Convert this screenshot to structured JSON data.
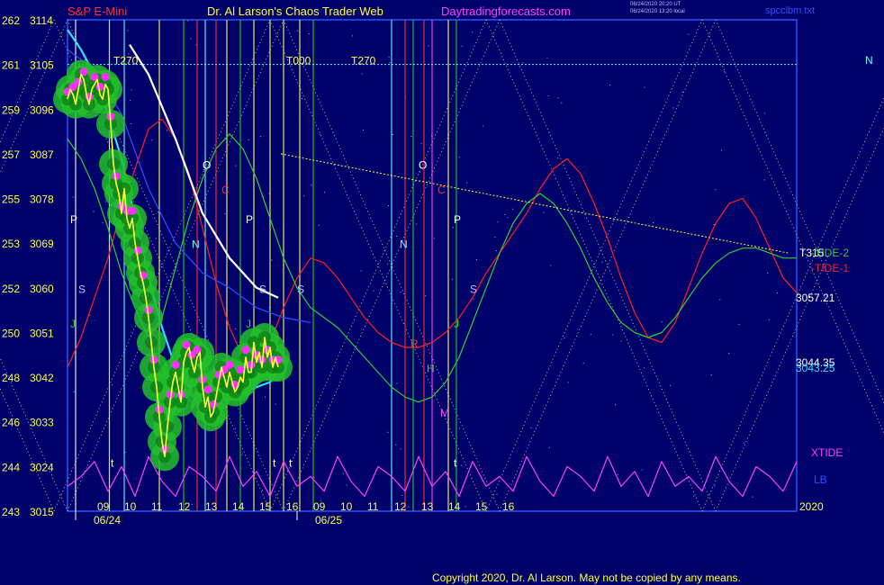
{
  "header": {
    "instrument": "S&P E-Mini",
    "title": "Dr. Al Larson's Chaos Trader Web",
    "site": "Daytradingforecasts.com",
    "stamp1": "06/24/2020 20:20 UT",
    "stamp2": "06/24/2020 13:20 local",
    "file": "spcclbm.txt"
  },
  "copyright": "Copyright 2020, Dr. Al Larson. May not be copied by any means.",
  "colors": {
    "background": "#00006a",
    "frame": "#2a52ff",
    "price": "#ffff40",
    "band": "#22c02a",
    "dots": "#ff30ff",
    "cyan_avg": "#30e0ff",
    "white_avg": "#ffffff",
    "tide1": "#ff2020",
    "tide2": "#30d030",
    "xtide": "#ff40ff"
  },
  "chart_data": {
    "type": "line",
    "ylim": [
      3015,
      3114
    ],
    "y_ticks": [
      {
        "left": "262",
        "right": "3114",
        "v": 3114
      },
      {
        "left": "261",
        "right": "3105",
        "v": 3105
      },
      {
        "left": "259",
        "right": "3096",
        "v": 3096
      },
      {
        "left": "257",
        "right": "3087",
        "v": 3087
      },
      {
        "left": "255",
        "right": "3078",
        "v": 3078
      },
      {
        "left": "253",
        "right": "3069",
        "v": 3069
      },
      {
        "left": "252",
        "right": "3060",
        "v": 3060
      },
      {
        "left": "250",
        "right": "3051",
        "v": 3051
      },
      {
        "left": "248",
        "right": "3042",
        "v": 3042
      },
      {
        "left": "246",
        "right": "3033",
        "v": 3033
      },
      {
        "left": "244",
        "right": "3024",
        "v": 3024
      },
      {
        "left": "243",
        "right": "3015",
        "v": 3015
      }
    ],
    "x_range": [
      0,
      27
    ],
    "x_ticks": [
      {
        "t": 1,
        "label": "09"
      },
      {
        "t": 2,
        "label": "10"
      },
      {
        "t": 3,
        "label": "11"
      },
      {
        "t": 4,
        "label": "12"
      },
      {
        "t": 5,
        "label": "13"
      },
      {
        "t": 6,
        "label": "14"
      },
      {
        "t": 7,
        "label": "15"
      },
      {
        "t": 8,
        "label": "16"
      },
      {
        "t": 9,
        "label": "09"
      },
      {
        "t": 10,
        "label": "10"
      },
      {
        "t": 11,
        "label": "11"
      },
      {
        "t": 12,
        "label": "12"
      },
      {
        "t": 13,
        "label": "13"
      },
      {
        "t": 14,
        "label": "14"
      },
      {
        "t": 15,
        "label": "15"
      },
      {
        "t": 16,
        "label": "16"
      }
    ],
    "dates": [
      {
        "t": 0.3,
        "label": "06/24"
      },
      {
        "t": 8.5,
        "label": "06/25"
      }
    ],
    "year_label": "2020",
    "price_series": {
      "x": [
        0.0,
        0.1,
        0.2,
        0.3,
        0.4,
        0.5,
        0.6,
        0.7,
        0.8,
        0.9,
        1.0,
        1.1,
        1.2,
        1.3,
        1.4,
        1.5,
        1.6,
        1.7,
        1.8,
        1.9,
        2.0,
        2.1,
        2.2,
        2.3,
        2.4,
        2.5,
        2.6,
        2.7,
        2.8,
        2.9,
        3.0,
        3.1,
        3.2,
        3.3,
        3.4,
        3.5,
        3.6,
        3.7,
        3.8,
        3.9,
        4.0,
        4.1,
        4.2,
        4.3,
        4.4,
        4.5,
        4.6,
        4.7,
        4.8,
        4.9,
        5.0,
        5.1,
        5.2,
        5.3,
        5.4,
        5.5,
        5.6,
        5.7,
        5.8,
        5.9,
        6.0,
        6.1,
        6.2,
        6.3,
        6.4,
        6.5,
        6.6,
        6.7,
        6.8,
        6.9,
        7.0,
        7.1,
        7.2,
        7.3,
        7.4,
        7.5,
        7.6,
        7.7,
        7.8
      ],
      "y": [
        3098,
        3100,
        3099,
        3097,
        3100,
        3103,
        3102,
        3099,
        3097,
        3100,
        3101,
        3102,
        3099,
        3098,
        3101,
        3100,
        3093,
        3085,
        3081,
        3079,
        3075,
        3080,
        3074,
        3072,
        3074,
        3069,
        3066,
        3063,
        3061,
        3058,
        3054,
        3049,
        3044,
        3040,
        3034,
        3029,
        3026,
        3032,
        3037,
        3041,
        3043,
        3040,
        3037,
        3045,
        3047,
        3048,
        3045,
        3043,
        3046,
        3047,
        3040,
        3036,
        3038,
        3034,
        3035,
        3038,
        3041,
        3044,
        3042,
        3040,
        3043,
        3041,
        3039,
        3040,
        3042,
        3041,
        3046,
        3043,
        3043,
        3049,
        3045,
        3047,
        3044,
        3050,
        3046,
        3048,
        3044,
        3046,
        3044
      ]
    },
    "series": [
      {
        "name": "-TIDE-1",
        "end_value": 3060,
        "x": [
          0,
          0.5,
          1,
          1.5,
          2,
          2.5,
          3,
          3.5,
          4,
          4.5,
          5,
          5.5,
          6,
          6.5,
          7,
          7.5,
          8,
          8.5,
          9,
          9.5,
          10,
          10.5,
          11,
          11.5,
          12,
          12.5,
          13,
          13.5,
          14,
          14.5,
          15,
          15.5,
          16,
          16.5,
          17,
          17.5,
          18,
          18.5,
          19,
          19.5,
          20,
          20.5,
          21,
          21.5,
          22,
          22.5,
          23,
          23.5,
          24,
          24.5,
          25,
          25.5,
          26,
          26.5,
          27
        ],
        "y": [
          3044,
          3050,
          3058,
          3066,
          3076,
          3084,
          3092,
          3094,
          3090,
          3083,
          3072,
          3061,
          3052,
          3046,
          3045,
          3049,
          3056,
          3062,
          3066,
          3065,
          3062,
          3058,
          3054,
          3051,
          3049,
          3048,
          3048,
          3049,
          3051,
          3054,
          3058,
          3063,
          3067,
          3071,
          3075,
          3080,
          3084,
          3086,
          3083,
          3077,
          3070,
          3062,
          3055,
          3050,
          3049,
          3053,
          3060,
          3067,
          3073,
          3077,
          3078,
          3074,
          3068,
          3062,
          3059
        ]
      },
      {
        "name": "-TIDE-2",
        "end_value": 3066,
        "x": [
          0,
          0.5,
          1,
          1.5,
          2,
          2.5,
          3,
          3.5,
          4,
          4.5,
          5,
          5.5,
          6,
          6.5,
          7,
          7.5,
          8,
          8.5,
          9,
          9.5,
          10,
          10.5,
          11,
          11.5,
          12,
          12.5,
          13,
          13.5,
          14,
          14.5,
          15,
          15.5,
          16,
          16.5,
          17,
          17.5,
          18,
          18.5,
          19,
          19.5,
          20,
          20.5,
          21,
          21.5,
          22,
          22.5,
          23,
          23.5,
          24,
          24.5,
          25,
          25.5,
          26,
          26.5,
          27
        ],
        "y": [
          3090,
          3086,
          3080,
          3072,
          3063,
          3056,
          3050,
          3054,
          3064,
          3074,
          3082,
          3088,
          3091,
          3088,
          3082,
          3074,
          3066,
          3060,
          3056,
          3054,
          3052,
          3049,
          3046,
          3043,
          3040,
          3038,
          3037,
          3038,
          3041,
          3046,
          3053,
          3060,
          3067,
          3073,
          3077,
          3079,
          3077,
          3073,
          3068,
          3062,
          3057,
          3053,
          3051,
          3050,
          3051,
          3054,
          3058,
          3062,
          3065,
          3067,
          3068,
          3068,
          3067,
          3066,
          3066
        ]
      },
      {
        "name": "XTIDE",
        "end_value": 3025,
        "x": [
          0,
          0.5,
          1,
          1.5,
          2,
          2.5,
          3,
          3.5,
          4,
          4.5,
          5,
          5.5,
          6,
          6.5,
          7,
          7.5,
          8,
          8.5,
          9,
          9.5,
          10,
          10.5,
          11,
          11.5,
          12,
          12.5,
          13,
          13.5,
          14,
          14.5,
          15,
          15.5,
          16,
          16.5,
          17,
          17.5,
          18,
          18.5,
          19,
          19.5,
          20,
          20.5,
          21,
          21.5,
          22,
          22.5,
          23,
          23.5,
          24,
          24.5,
          25,
          25.5,
          26,
          26.5,
          27
        ],
        "y": [
          3020,
          3022,
          3025,
          3019,
          3024,
          3018,
          3026,
          3021,
          3018,
          3024,
          3022,
          3019,
          3026,
          3020,
          3023,
          3018,
          3025,
          3020,
          3022,
          3019,
          3026,
          3021,
          3018,
          3024,
          3022,
          3019,
          3026,
          3020,
          3023,
          3018,
          3025,
          3020,
          3022,
          3019,
          3026,
          3021,
          3018,
          3024,
          3022,
          3019,
          3026,
          3020,
          3023,
          3018,
          3025,
          3020,
          3022,
          3019,
          3026,
          3021,
          3018,
          3024,
          3022,
          3019,
          3025
        ]
      },
      {
        "name": "cyan-average",
        "end_value": 3043.25,
        "x": [
          0,
          0.5,
          1,
          1.5,
          2,
          2.5,
          3,
          3.5,
          4,
          4.5,
          5,
          5.5,
          6,
          6.5,
          7,
          7.5,
          7.8
        ],
        "y": [
          3112,
          3108,
          3103,
          3095,
          3086,
          3074,
          3062,
          3052,
          3044,
          3040,
          3041,
          3040,
          3038,
          3039,
          3040,
          3041,
          3043.25
        ]
      },
      {
        "name": "white-average",
        "x": [
          2.3,
          3,
          4,
          5,
          6,
          7,
          7.8
        ],
        "y": [
          3109,
          3103,
          3090,
          3075,
          3066,
          3060,
          3058
        ]
      },
      {
        "name": "blue-average",
        "x": [
          0,
          1,
          2,
          3,
          4,
          5,
          6,
          7,
          8,
          9
        ],
        "y": [
          3108,
          3104,
          3095,
          3080,
          3069,
          3063,
          3060,
          3056,
          3054,
          3053
        ]
      }
    ],
    "right_values": [
      "3057.21",
      "3044.35",
      "3043.25"
    ],
    "trend_line": {
      "x": [
        7.9,
        26.7
      ],
      "y": [
        3087,
        3067
      ]
    },
    "vlines": [
      {
        "t": 0.3,
        "c": "#ffffff"
      },
      {
        "t": 1.55,
        "c": "#ffff60"
      },
      {
        "t": 2.1,
        "c": "#60ffff"
      },
      {
        "t": 3.4,
        "c": "#ffff60"
      },
      {
        "t": 4.3,
        "c": "#20d020"
      },
      {
        "t": 4.8,
        "c": "#ff3030"
      },
      {
        "t": 5.1,
        "c": "#60ffff"
      },
      {
        "t": 5.5,
        "c": "#ff3030"
      },
      {
        "t": 5.9,
        "c": "#ffff60"
      },
      {
        "t": 6.4,
        "c": "#20d020"
      },
      {
        "t": 6.9,
        "c": "#ffff60"
      },
      {
        "t": 7.5,
        "c": "#ffff60"
      },
      {
        "t": 8.0,
        "c": "#ffff60"
      },
      {
        "t": 8.6,
        "c": "#ffff60"
      },
      {
        "t": 9.1,
        "c": "#20d020"
      },
      {
        "t": 12.0,
        "c": "#60ffff"
      },
      {
        "t": 12.5,
        "c": "#ff3030"
      },
      {
        "t": 12.8,
        "c": "#20d020"
      },
      {
        "t": 13.2,
        "c": "#ff3030"
      },
      {
        "t": 13.5,
        "c": "#ff40ff"
      },
      {
        "t": 14.1,
        "c": "#ffff60"
      },
      {
        "t": 14.4,
        "c": "#20d020"
      }
    ],
    "hline": {
      "v": 3105,
      "c": "#60ffff"
    },
    "markers": [
      {
        "label": "T270",
        "t": 1.7,
        "v": 3105,
        "c": "#ffff60"
      },
      {
        "label": "T000",
        "t": 8.1,
        "v": 3105,
        "c": "#ffff60"
      },
      {
        "label": "T270",
        "t": 10.5,
        "v": 3105,
        "c": "#ffff60"
      },
      {
        "label": "P",
        "t": 0.1,
        "v": 3073,
        "c": "#ffffff"
      },
      {
        "label": "S",
        "t": 0.4,
        "v": 3059,
        "c": "#c0c0ff"
      },
      {
        "label": "J",
        "t": 0.1,
        "v": 3052,
        "c": "#30d030"
      },
      {
        "label": "O",
        "t": 5.0,
        "v": 3084,
        "c": "#ffffff"
      },
      {
        "label": "C",
        "t": 5.7,
        "v": 3079,
        "c": "#ff3030"
      },
      {
        "label": "N",
        "t": 4.6,
        "v": 3068,
        "c": "#60ffff"
      },
      {
        "label": "P",
        "t": 6.6,
        "v": 3073,
        "c": "#ffffff"
      },
      {
        "label": "S",
        "t": 7.1,
        "v": 3059,
        "c": "#c0c0ff"
      },
      {
        "label": "J",
        "t": 6.6,
        "v": 3052,
        "c": "#30d030"
      },
      {
        "label": "S",
        "t": 8.5,
        "v": 3059,
        "c": "#c0c0ff"
      },
      {
        "label": "O",
        "t": 13.0,
        "v": 3084,
        "c": "#ffffff"
      },
      {
        "label": "C",
        "t": 13.7,
        "v": 3079,
        "c": "#ff3030"
      },
      {
        "label": "N",
        "t": 12.3,
        "v": 3068,
        "c": "#60ffff"
      },
      {
        "label": "P",
        "t": 14.3,
        "v": 3073,
        "c": "#ffffff"
      },
      {
        "label": "S",
        "t": 14.9,
        "v": 3059,
        "c": "#c0c0ff"
      },
      {
        "label": "J",
        "t": 14.3,
        "v": 3052,
        "c": "#30d030"
      },
      {
        "label": "R",
        "t": 12.7,
        "v": 3048,
        "c": "#ff3030"
      },
      {
        "label": "H",
        "t": 13.3,
        "v": 3043,
        "c": "#30d030"
      },
      {
        "label": "M",
        "t": 13.8,
        "v": 3034,
        "c": "#ff40ff"
      },
      {
        "label": "t",
        "t": 1.6,
        "v": 3024,
        "c": "#ffffff"
      },
      {
        "label": "t",
        "t": 7.6,
        "v": 3024,
        "c": "#ffffff"
      },
      {
        "label": "t",
        "t": 8.2,
        "v": 3024,
        "c": "#ffffff"
      },
      {
        "label": "t",
        "t": 14.3,
        "v": 3024,
        "c": "#ffffff"
      }
    ],
    "legend": {
      "tide2": "-TIDE-2",
      "tide1": "-TIDE-1",
      "xtide": "XTIDE",
      "lb": "LB",
      "t315": "T315",
      "n_marker": "N"
    }
  }
}
